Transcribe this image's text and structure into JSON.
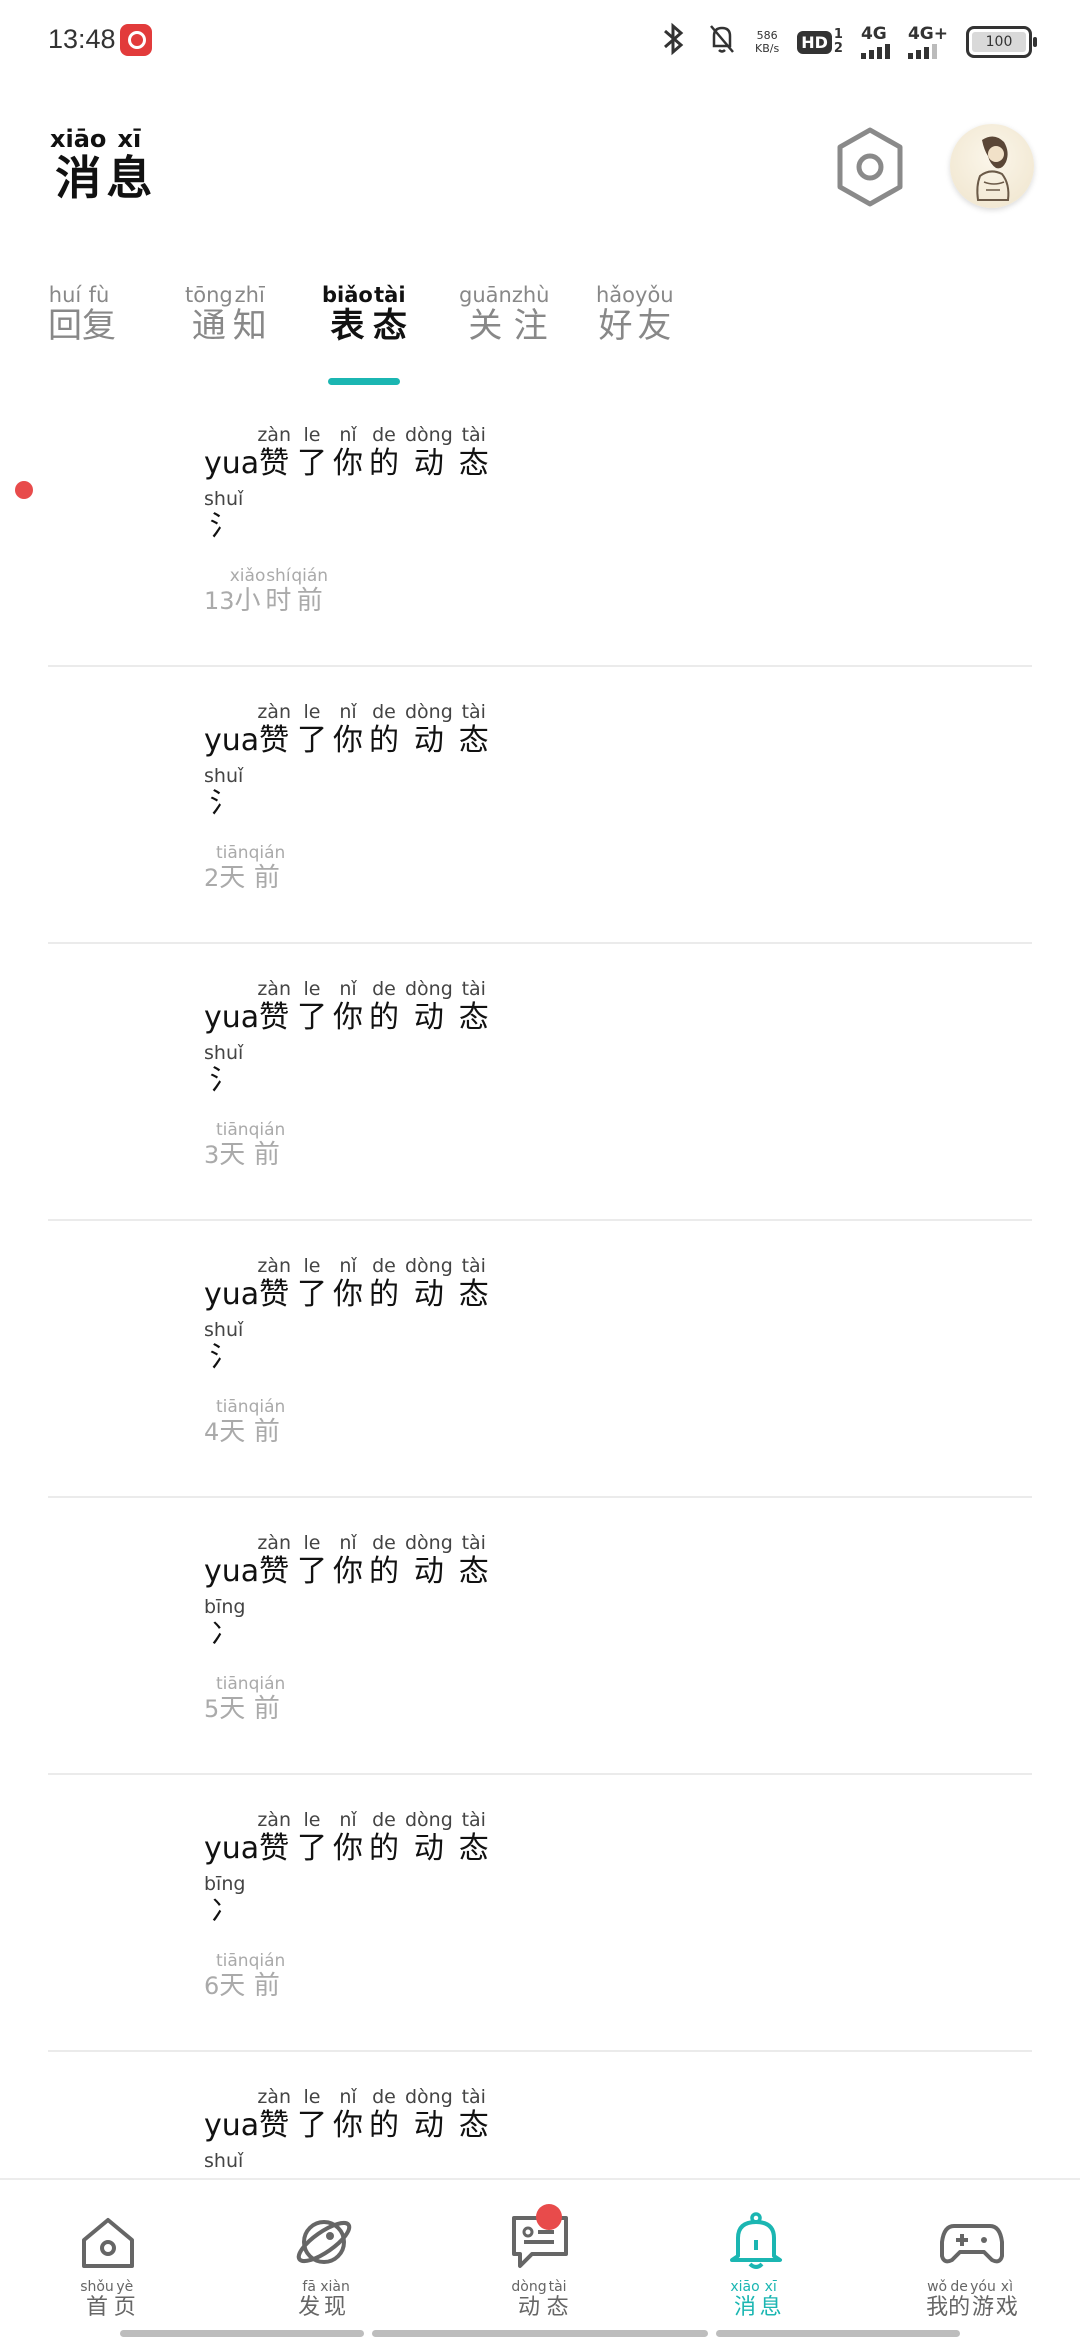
{
  "status_bar": {
    "time": "13:48",
    "net_speed_value": "586",
    "net_speed_unit": "KB/s",
    "hd_label": "HD",
    "sim1": "1",
    "sim2": "2",
    "signal1_label": "4G",
    "signal2_label": "4G+",
    "battery": "100"
  },
  "header": {
    "title_chars": [
      {
        "char": "消",
        "pinyin": "xiāo"
      },
      {
        "char": "息",
        "pinyin": "xī"
      }
    ]
  },
  "tabs": [
    {
      "chars": [
        {
          "char": "回",
          "pinyin": "huí"
        },
        {
          "char": "复",
          "pinyin": "fù"
        }
      ],
      "active": false
    },
    {
      "chars": [
        {
          "char": "通",
          "pinyin": "tōng"
        },
        {
          "char": "知",
          "pinyin": "zhī"
        }
      ],
      "active": false
    },
    {
      "chars": [
        {
          "char": "表",
          "pinyin": "biǎo"
        },
        {
          "char": "态",
          "pinyin": "tài"
        }
      ],
      "active": true
    },
    {
      "chars": [
        {
          "char": "关",
          "pinyin": "guān"
        },
        {
          "char": "注",
          "pinyin": "zhù"
        }
      ],
      "active": false
    },
    {
      "chars": [
        {
          "char": "好",
          "pinyin": "hǎo"
        },
        {
          "char": "友",
          "pinyin": "yǒu"
        }
      ],
      "active": false
    }
  ],
  "message_template": [
    {
      "char": "赞",
      "pinyin": "zàn"
    },
    {
      "char": "了",
      "pinyin": "le"
    },
    {
      "char": "你",
      "pinyin": "nǐ"
    },
    {
      "char": "的",
      "pinyin": "de"
    },
    {
      "char": "动",
      "pinyin": "dòng"
    },
    {
      "char": "态",
      "pinyin": "tài"
    }
  ],
  "messages": [
    {
      "user": "yua",
      "unread": true,
      "sub_char": "氵",
      "sub_pinyin": "shuǐ",
      "time_num": "13",
      "time_chars": [
        {
          "char": "小",
          "pinyin": "xiǎo"
        },
        {
          "char": "时",
          "pinyin": "shí"
        },
        {
          "char": "前",
          "pinyin": "qián"
        }
      ]
    },
    {
      "user": "yua",
      "unread": false,
      "sub_char": "氵",
      "sub_pinyin": "shuǐ",
      "time_num": "2",
      "time_chars": [
        {
          "char": "天",
          "pinyin": "tiān"
        },
        {
          "char": "前",
          "pinyin": "qián"
        }
      ]
    },
    {
      "user": "yua",
      "unread": false,
      "sub_char": "氵",
      "sub_pinyin": "shuǐ",
      "time_num": "3",
      "time_chars": [
        {
          "char": "天",
          "pinyin": "tiān"
        },
        {
          "char": "前",
          "pinyin": "qián"
        }
      ]
    },
    {
      "user": "yua",
      "unread": false,
      "sub_char": "氵",
      "sub_pinyin": "shuǐ",
      "time_num": "4",
      "time_chars": [
        {
          "char": "天",
          "pinyin": "tiān"
        },
        {
          "char": "前",
          "pinyin": "qián"
        }
      ]
    },
    {
      "user": "yua",
      "unread": false,
      "sub_char": "冫",
      "sub_pinyin": "bīng",
      "time_num": "5",
      "time_chars": [
        {
          "char": "天",
          "pinyin": "tiān"
        },
        {
          "char": "前",
          "pinyin": "qián"
        }
      ]
    },
    {
      "user": "yua",
      "unread": false,
      "sub_char": "冫",
      "sub_pinyin": "bīng",
      "time_num": "6",
      "time_chars": [
        {
          "char": "天",
          "pinyin": "tiān"
        },
        {
          "char": "前",
          "pinyin": "qián"
        }
      ]
    },
    {
      "user": "yua",
      "unread": false,
      "sub_char": "",
      "sub_pinyin": "shuǐ",
      "time_num": "",
      "time_chars": []
    }
  ],
  "bottom_nav": [
    {
      "icon": "home-icon",
      "chars": [
        {
          "char": "首",
          "pinyin": "shǒu"
        },
        {
          "char": "页",
          "pinyin": "yè"
        }
      ],
      "active": false,
      "badge": false
    },
    {
      "icon": "planet-icon",
      "chars": [
        {
          "char": "发",
          "pinyin": "fā"
        },
        {
          "char": "现",
          "pinyin": "xiàn"
        }
      ],
      "active": false,
      "badge": false
    },
    {
      "icon": "chat-card-icon",
      "chars": [
        {
          "char": "动",
          "pinyin": "dòng"
        },
        {
          "char": "态",
          "pinyin": "tài"
        }
      ],
      "active": false,
      "badge": true
    },
    {
      "icon": "bell-icon",
      "chars": [
        {
          "char": "消",
          "pinyin": "xiāo"
        },
        {
          "char": "息",
          "pinyin": "xī"
        }
      ],
      "active": true,
      "badge": false
    },
    {
      "icon": "gamepad-icon",
      "chars": [
        {
          "char": "我",
          "pinyin": "wǒ"
        },
        {
          "char": "的",
          "pinyin": "de"
        },
        {
          "char": "游",
          "pinyin": "yóu"
        },
        {
          "char": "戏",
          "pinyin": "xì"
        }
      ],
      "active": false,
      "badge": false
    }
  ],
  "colors": {
    "accent": "#1bb6b2",
    "badge": "#e84b4b",
    "muted_text": "#aaaaaa"
  }
}
